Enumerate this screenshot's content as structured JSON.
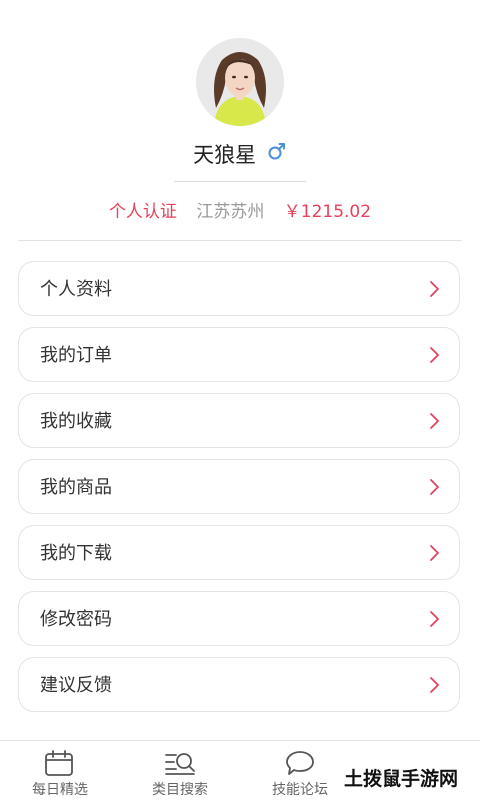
{
  "profile": {
    "name": "天狼星",
    "gender_icon": "male-icon",
    "verification": "个人认证",
    "location": "江苏苏州",
    "balance": "￥1215.02"
  },
  "menu": {
    "items": [
      {
        "label": "个人资料"
      },
      {
        "label": "我的订单"
      },
      {
        "label": "我的收藏"
      },
      {
        "label": "我的商品"
      },
      {
        "label": "我的下载"
      },
      {
        "label": "修改密码"
      },
      {
        "label": "建议反馈"
      }
    ]
  },
  "tabbar": {
    "tabs": [
      {
        "label": "每日精选",
        "icon": "calendar-icon"
      },
      {
        "label": "类目搜索",
        "icon": "search-list-icon"
      },
      {
        "label": "技能论坛",
        "icon": "chat-bubble-icon"
      }
    ]
  },
  "watermark": "土拨鼠手游网",
  "colors": {
    "accent": "#e8405a",
    "gender_blue": "#4a90d9",
    "muted_text": "#9a9a9a"
  }
}
